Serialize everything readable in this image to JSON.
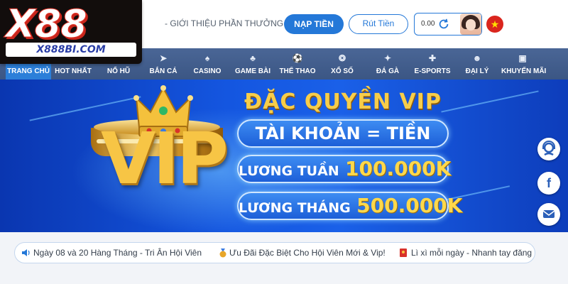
{
  "brand": {
    "logo_main": "X88",
    "logo_sub": "X888BI.COM"
  },
  "header": {
    "intro_link": "- GIỚI THIỆU PHẦN THƯỞNG",
    "deposit_label": "NẠP TIỀN",
    "withdraw_label": "Rút Tiền",
    "balance": "0.00",
    "language_icon": "vietnam-flag-icon"
  },
  "nav": {
    "items": [
      {
        "label": "TRANG CHỦ",
        "icon": "home-icon",
        "active": true
      },
      {
        "label": "HOT NHẤT",
        "icon": "fire-icon",
        "active": false
      },
      {
        "label": "NỔ HŨ",
        "icon": "jackpot-icon",
        "active": false
      },
      {
        "label": "BẮN CÁ",
        "icon": "fish-icon",
        "active": false
      },
      {
        "label": "CASINO",
        "icon": "casino-icon",
        "active": false
      },
      {
        "label": "GAME BÀI",
        "icon": "cards-icon",
        "active": false
      },
      {
        "label": "THỂ THAO",
        "icon": "soccer-ball-icon",
        "active": false
      },
      {
        "label": "XỔ SỐ",
        "icon": "lottery-icon",
        "active": false
      },
      {
        "label": "ĐÁ GÀ",
        "icon": "rooster-icon",
        "active": false
      },
      {
        "label": "E-SPORTS",
        "icon": "gamepad-icon",
        "active": false
      },
      {
        "label": "ĐẠI LÝ",
        "icon": "agent-icon",
        "active": false
      },
      {
        "label": "KHUYẾN MÃI",
        "icon": "gift-icon",
        "active": false
      }
    ]
  },
  "banner": {
    "vip_big": "VIP",
    "title": "ĐẶC QUYỀN VIP",
    "line1": "TÀI KHOẢN = TIỀN",
    "line2_label": "LƯƠNG TUẦN",
    "line2_amount": "100.000K",
    "line3_label": "LƯƠNG THÁNG",
    "line3_amount": "500.000K"
  },
  "side_buttons": [
    {
      "icon": "support-agent-icon"
    },
    {
      "icon": "facebook-icon"
    },
    {
      "icon": "message-icon"
    }
  ],
  "marquee": {
    "items": [
      {
        "icon": "speaker-icon",
        "text": "Ngày 08 và 20 Hàng Tháng - Tri Ân Hội Viên"
      },
      {
        "icon": "medal-icon",
        "text": "Ưu Đãi Đặc Biệt Cho Hội Viên Mới & Vip!"
      },
      {
        "icon": "red-envelope-icon",
        "text": "Lì xì mỗi ngày - Nhanh tay đăng k"
      }
    ]
  },
  "colors": {
    "primary": "#2478d8",
    "nav_bg": "#3b5684",
    "nav_active": "#2c7fd9",
    "gold": "#f7c545"
  }
}
